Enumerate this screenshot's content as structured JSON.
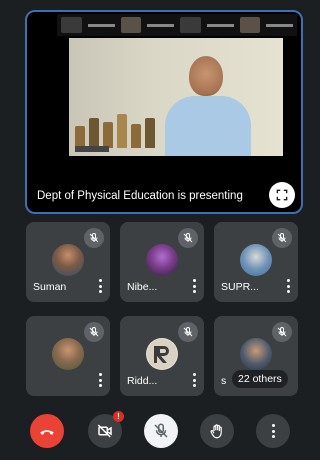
{
  "presentation": {
    "status_text": "Dept of Physical Education is presenting",
    "fullscreen_icon": "fullscreen-icon"
  },
  "participants": [
    {
      "name": "Suman",
      "avatar_color": "#6d5a4a",
      "muted": true
    },
    {
      "name": "Nibe...",
      "avatar_color": "#7a3e8a",
      "muted": true
    },
    {
      "name": "SUPR...",
      "avatar_color": "#3d6f94",
      "muted": true
    },
    {
      "name": "",
      "avatar_color": "#5d6b4a",
      "muted": true
    },
    {
      "name": "Ridd...",
      "avatar_color": "#b8b2a8",
      "muted": true
    },
    {
      "name": "s",
      "avatar_color": "#3e4b5c",
      "muted": false
    }
  ],
  "others_label": "22 others",
  "controls": {
    "end_call": {
      "icon": "hang-up-icon",
      "color": "#ea4335"
    },
    "camera": {
      "icon": "camera-off-icon",
      "badge": "!"
    },
    "mic": {
      "icon": "mic-off-icon"
    },
    "raise_hand": {
      "icon": "raise-hand-icon"
    },
    "more": {
      "icon": "more-vert-icon"
    }
  }
}
